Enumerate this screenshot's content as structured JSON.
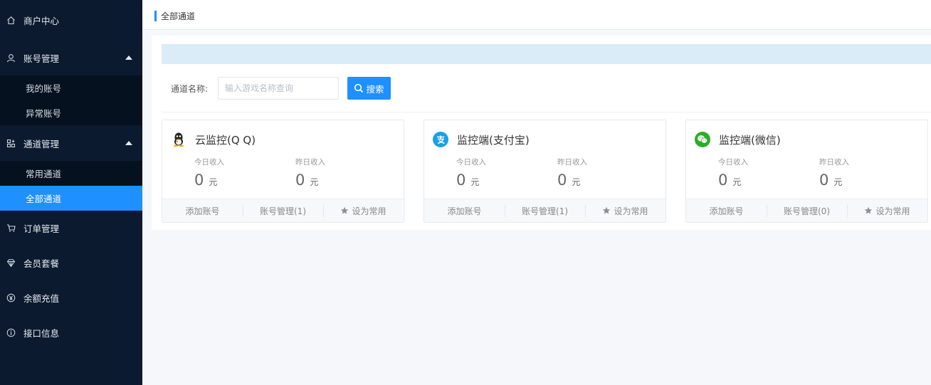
{
  "sidebar": {
    "top_item": {
      "label": "商户中心",
      "icon": "home-icon"
    },
    "groups": [
      {
        "label": "账号管理",
        "icon": "user-icon",
        "items": [
          "我的账号",
          "异常账号"
        ]
      },
      {
        "label": "通道管理",
        "icon": "apps-icon",
        "items": [
          "常用通道",
          "全部通道"
        ]
      }
    ],
    "bottom_items": [
      {
        "label": "订单管理",
        "icon": "cart-icon"
      },
      {
        "label": "会员套餐",
        "icon": "diamond-icon"
      },
      {
        "label": "余额充值",
        "icon": "yen-icon"
      },
      {
        "label": "接口信息",
        "icon": "info-icon"
      }
    ],
    "active_item": "全部通道"
  },
  "breadcrumb": {
    "title": "全部通道"
  },
  "search": {
    "label": "通道名称:",
    "placeholder": "输入游戏名称查询",
    "button_label": "搜索"
  },
  "cards": [
    {
      "title": "云监控(Q Q)",
      "icon": "qq-icon",
      "today_label": "今日收入",
      "today_value": "0",
      "yesterday_label": "昨日收入",
      "yesterday_value": "0",
      "unit": "元",
      "add_label": "添加账号",
      "manage_label": "账号管理(1)",
      "favorite_label": "设为常用"
    },
    {
      "title": "监控端(支付宝)",
      "icon": "alipay-icon",
      "today_label": "今日收入",
      "today_value": "0",
      "yesterday_label": "昨日收入",
      "yesterday_value": "0",
      "unit": "元",
      "add_label": "添加账号",
      "manage_label": "账号管理(1)",
      "favorite_label": "设为常用"
    },
    {
      "title": "监控端(微信)",
      "icon": "wechat-icon",
      "today_label": "今日收入",
      "today_value": "0",
      "yesterday_label": "昨日收入",
      "yesterday_value": "0",
      "unit": "元",
      "add_label": "添加账号",
      "manage_label": "账号管理(0)",
      "favorite_label": "设为常用"
    }
  ],
  "colors": {
    "accent": "#1e90ff",
    "sidebar_bg": "#0b1a2e",
    "alipay": "#1aa1e6",
    "wechat": "#2aae2a"
  }
}
